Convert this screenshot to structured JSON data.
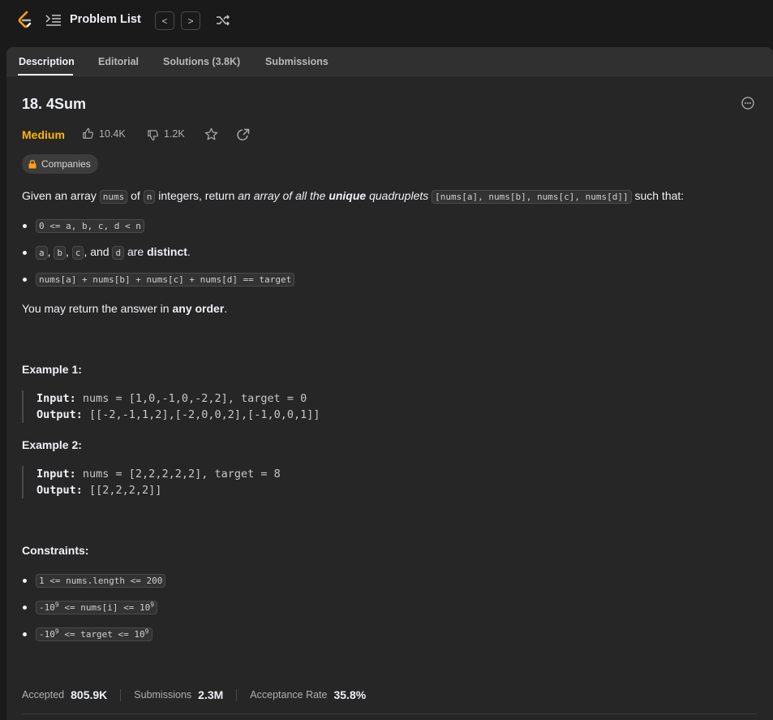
{
  "topbar": {
    "problem_list_label": "Problem List",
    "prev_label": "<",
    "next_label": ">"
  },
  "tabs": [
    {
      "label": "Description",
      "active": true
    },
    {
      "label": "Editorial",
      "active": false
    },
    {
      "label": "Solutions (3.8K)",
      "active": false
    },
    {
      "label": "Submissions",
      "active": false
    }
  ],
  "problem": {
    "title": "18. 4Sum",
    "difficulty": "Medium",
    "difficulty_color": "#ffb800",
    "likes": "10.4K",
    "dislikes": "1.2K",
    "companies_label": "Companies"
  },
  "description": {
    "intro_1": "Given an array ",
    "intro_code_nums": "nums",
    "intro_2": " of ",
    "intro_code_n": "n",
    "intro_3": " integers, return ",
    "intro_em_1": "an array of all the ",
    "intro_em_bold": "unique",
    "intro_em_2": " quadruplets",
    "intro_code_quad": "[nums[a], nums[b], nums[c], nums[d]]",
    "intro_4": " such that:",
    "bullet_1_code": "0 <= a, b, c, d < n",
    "bullet_2_code_a": "a",
    "bullet_2_sep1": ", ",
    "bullet_2_code_b": "b",
    "bullet_2_sep2": ", ",
    "bullet_2_code_c": "c",
    "bullet_2_and": ", and ",
    "bullet_2_code_d": "d",
    "bullet_2_are": " are ",
    "bullet_2_bold": "distinct",
    "bullet_2_end": ".",
    "bullet_3_code": "nums[a] + nums[b] + nums[c] + nums[d] == target",
    "order_1": "You may return the answer in ",
    "order_bold": "any order",
    "order_end": "."
  },
  "examples": [
    {
      "heading": "Example 1:",
      "input_label": "Input:",
      "input_value": " nums = [1,0,-1,0,-2,2], target = 0",
      "output_label": "Output:",
      "output_value": " [[-2,-1,1,2],[-2,0,0,2],[-1,0,0,1]]"
    },
    {
      "heading": "Example 2:",
      "input_label": "Input:",
      "input_value": " nums = [2,2,2,2,2], target = 8",
      "output_label": "Output:",
      "output_value": " [[2,2,2,2]]"
    }
  ],
  "constraints": {
    "heading": "Constraints:",
    "c1": "1 <= nums.length <= 200",
    "c2_pre": "-10",
    "c2_sup1": "9",
    "c2_mid": " <= nums[i] <= 10",
    "c2_sup2": "9",
    "c3_pre": "-10",
    "c3_sup1": "9",
    "c3_mid": " <= target <= 10",
    "c3_sup2": "9"
  },
  "stats": {
    "accepted_label": "Accepted",
    "accepted_value": "805.9K",
    "submissions_label": "Submissions",
    "submissions_value": "2.3M",
    "rate_label": "Acceptance Rate",
    "rate_value": "35.8%"
  }
}
